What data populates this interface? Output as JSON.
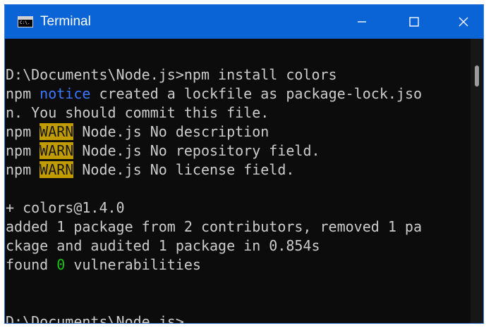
{
  "window": {
    "title": "Terminal",
    "icon_name": "terminal-icon",
    "icon_text": "C:\\."
  },
  "controls": {
    "minimize_icon": "minimize-icon",
    "maximize_icon": "maximize-icon",
    "close_icon": "close-icon"
  },
  "colors": {
    "titlebar": "#0a64d6",
    "terminal_bg": "#0c0c0c",
    "text": "#cccccc",
    "notice": "#3b78ff",
    "warn_bg": "#c19c00",
    "success": "#16c60c"
  },
  "terminal": {
    "line1": "D:\\Documents\\Node.js>npm install colors",
    "line2": {
      "prefix": "npm ",
      "notice": "notice",
      "rest": " created a lockfile as package-lock.jso"
    },
    "line3": "n. You should commit this file.",
    "line4": {
      "prefix": "npm ",
      "warn": "WARN",
      "rest": " Node.js No description"
    },
    "line5": {
      "prefix": "npm ",
      "warn": "WARN",
      "rest": " Node.js No repository field."
    },
    "line6": {
      "prefix": "npm ",
      "warn": "WARN",
      "rest": " Node.js No license field."
    },
    "line8": "+ colors@1.4.0",
    "line9": "added 1 package from 2 contributors, removed 1 pa",
    "line10": "ckage and audited 1 package in 0.854s",
    "line11": {
      "prefix": "found ",
      "count": "0",
      "rest": " vulnerabilities"
    },
    "line14": "D:\\Documents\\Node.js>"
  }
}
